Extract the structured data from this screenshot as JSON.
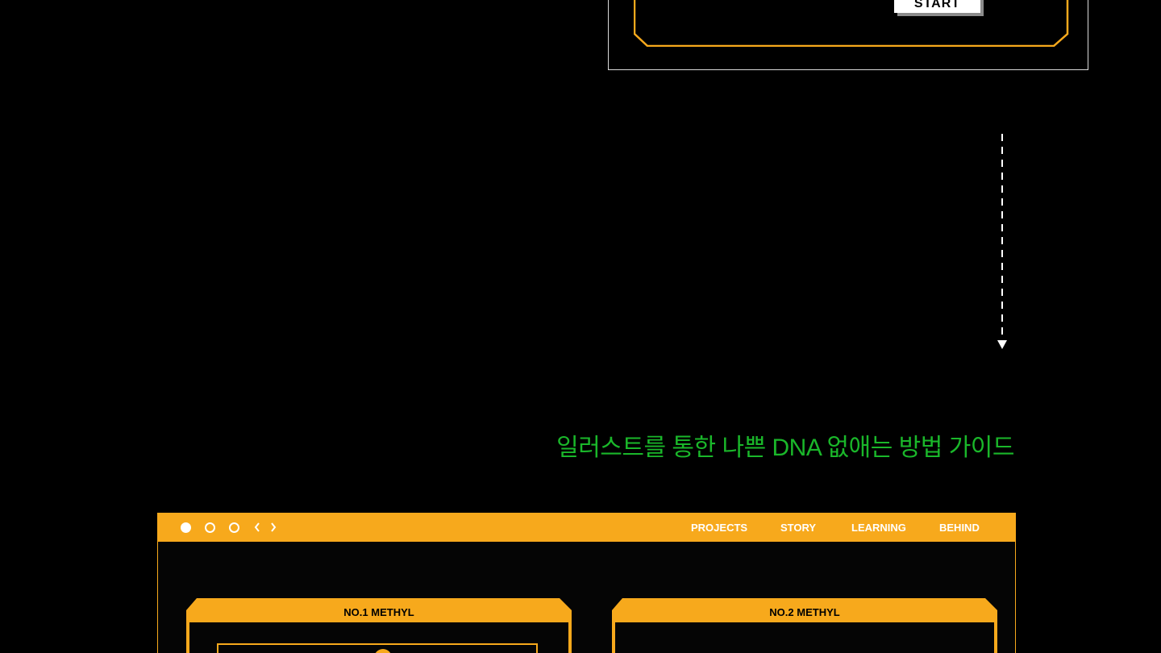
{
  "top_window": {
    "start_label": "START"
  },
  "guide": {
    "title": "일러스트를 통한 나쁜 DNA 없애는 방법 가이드"
  },
  "browser": {
    "nav_prev": "‹",
    "nav_next": "›",
    "menu": [
      "PROJECTS",
      "STORY",
      "LEARNING",
      "BEHIND"
    ]
  },
  "cards": [
    {
      "title": "NO.1  METHYL"
    },
    {
      "title": "NO.2  METHYL"
    }
  ],
  "colors": {
    "accent_orange": "#f7a91c",
    "heading_green": "#1ab72a",
    "background": "#000000"
  }
}
